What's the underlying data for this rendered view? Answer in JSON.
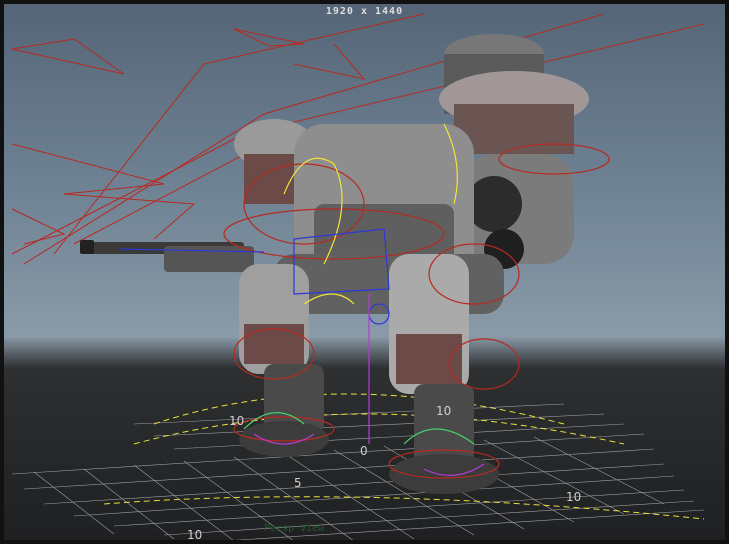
{
  "viewport": {
    "resolution_gate": "1920 x 1440",
    "grid_labels": [
      "10",
      "10",
      "0",
      "5",
      "10",
      "10"
    ],
    "status_text": "Persp View",
    "colors": {
      "sky_top": "#556577",
      "sky_bottom": "#8a9aa8",
      "ground": "#222325",
      "curve_red": "#b72a20",
      "curve_yellow": "#f0e53a",
      "curve_blue": "#2e38d8",
      "curve_purple": "#b43bd6",
      "curve_green": "#4bd06e"
    }
  }
}
